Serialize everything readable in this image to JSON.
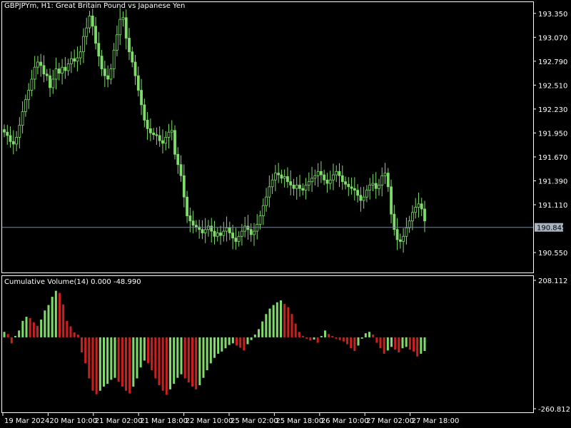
{
  "window": {
    "title": "GBPJPYm, H1:  Great Britain Pound vs Japanese Yen"
  },
  "indicator": {
    "title": "Cumulative Volume(14) 0.000 -48.990"
  },
  "colors": {
    "background": "#000000",
    "frame": "#ffffff",
    "bull": "#7fdc6a",
    "bear": "#cc1f1f",
    "price_line": "#7a8898",
    "price_label_bg": "#a9b4c2"
  },
  "chart_data": [
    {
      "type": "candlestick",
      "title": "GBPJPYm, H1:  Great Britain Pound vs Japanese Yen",
      "price_ticks": [
        "193.350",
        "193.070",
        "192.790",
        "192.510",
        "192.230",
        "191.950",
        "191.670",
        "191.390",
        "191.110",
        "190.550"
      ],
      "y_range": [
        190.35,
        193.44
      ],
      "current_price": "190.845",
      "close": [
        191.96,
        191.92,
        191.85,
        191.82,
        191.9,
        192.04,
        192.2,
        192.34,
        192.45,
        192.58,
        192.72,
        192.78,
        192.74,
        192.64,
        192.62,
        192.48,
        192.58,
        192.7,
        192.65,
        192.72,
        192.68,
        192.76,
        192.82,
        192.79,
        192.83,
        192.9,
        193.08,
        193.18,
        193.32,
        193.2,
        193.0,
        192.85,
        192.7,
        192.62,
        192.58,
        192.7,
        192.92,
        193.1,
        193.28,
        193.3,
        193.06,
        192.9,
        192.78,
        192.62,
        192.45,
        192.28,
        192.1,
        192.0,
        191.95,
        191.93,
        191.92,
        191.86,
        191.83,
        191.9,
        191.96,
        191.98,
        191.7,
        191.58,
        191.45,
        191.2,
        190.98,
        190.92,
        190.87,
        190.85,
        190.82,
        190.78,
        190.82,
        190.86,
        190.8,
        190.74,
        190.78,
        190.75,
        190.8,
        190.84,
        190.78,
        190.72,
        190.68,
        190.74,
        190.8,
        190.86,
        190.82,
        190.76,
        190.8,
        190.88,
        190.98,
        191.1,
        191.2,
        191.32,
        191.4,
        191.48,
        191.46,
        191.42,
        191.44,
        191.38,
        191.34,
        191.3,
        191.34,
        191.3,
        191.28,
        191.34,
        191.38,
        191.42,
        191.45,
        191.5,
        191.46,
        191.4,
        191.36,
        191.4,
        191.46,
        191.5,
        191.45,
        191.38,
        191.35,
        191.32,
        191.3,
        191.28,
        191.22,
        191.16,
        191.2,
        191.28,
        191.34,
        191.36,
        191.3,
        191.34,
        191.45,
        191.48,
        191.32,
        191.0,
        190.82,
        190.7,
        190.68,
        190.74,
        190.84,
        190.92,
        191.02,
        191.08,
        191.12,
        191.06,
        190.92
      ]
    },
    {
      "type": "bar",
      "title": "Cumulative Volume(14) 0.000 -48.990",
      "y_ticks": [
        "208.112",
        "-260.812"
      ],
      "y_range": [
        -260.812,
        208.112
      ],
      "values": [
        20,
        12,
        -22,
        5,
        25,
        60,
        75,
        70,
        55,
        42,
        65,
        98,
        118,
        148,
        170,
        162,
        120,
        60,
        40,
        18,
        10,
        -55,
        -95,
        -150,
        -195,
        -208,
        -195,
        -180,
        -170,
        -155,
        -148,
        -162,
        -180,
        -195,
        -205,
        -180,
        -150,
        -110,
        -85,
        -95,
        -120,
        -150,
        -175,
        -195,
        -210,
        -190,
        -170,
        -148,
        -135,
        -150,
        -165,
        -180,
        -190,
        -175,
        -148,
        -120,
        -95,
        -75,
        -60,
        -52,
        -40,
        -28,
        -22,
        -30,
        -38,
        -48,
        -25,
        -10,
        10,
        30,
        58,
        85,
        105,
        118,
        128,
        135,
        122,
        110,
        85,
        50,
        20,
        5,
        -5,
        -12,
        -8,
        -20,
        5,
        25,
        12,
        5,
        -5,
        -10,
        -15,
        -25,
        -40,
        -50,
        -30,
        -5,
        15,
        20,
        10,
        -20,
        -40,
        -60,
        -48,
        -35,
        -45,
        -55,
        -40,
        -35,
        -45,
        -52,
        -70,
        -60,
        -50
      ]
    }
  ],
  "time_axis": {
    "labels": [
      "19 Mar 2024",
      "20 Mar 10:00",
      "21 Mar 02:00",
      "21 Mar 18:00",
      "22 Mar 10:00",
      "25 Mar 02:00",
      "25 Mar 18:00",
      "26 Mar 10:00",
      "27 Mar 02:00",
      "27 Mar 18:00"
    ]
  }
}
